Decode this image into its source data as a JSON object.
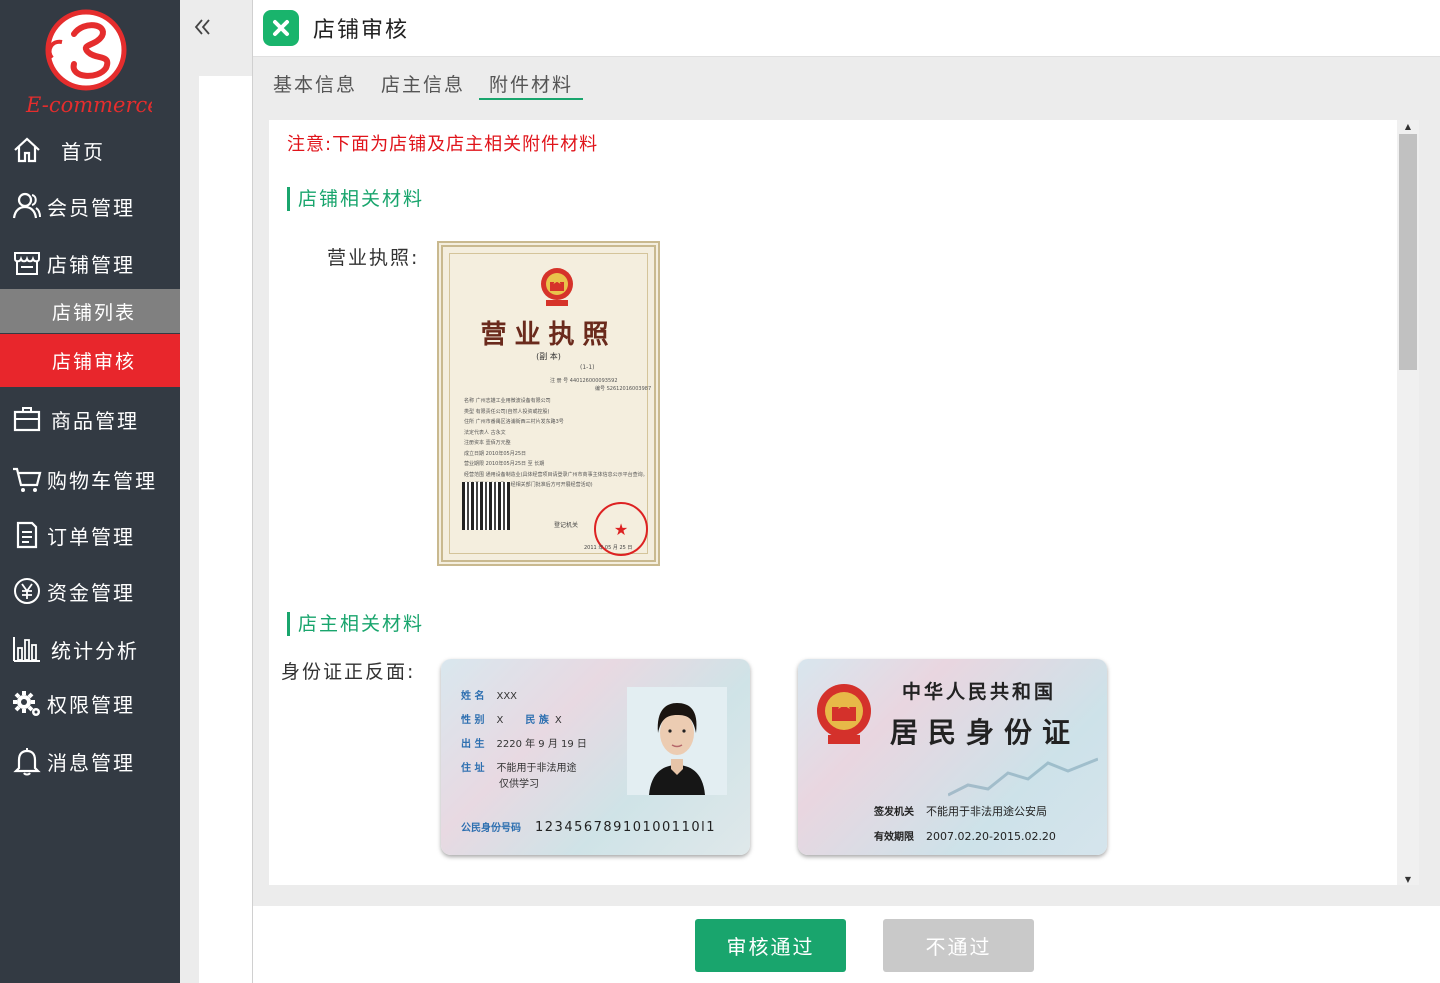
{
  "sidebar": {
    "logo_text": "E-commerce",
    "items": [
      {
        "label": "首页",
        "icon": "home-icon"
      },
      {
        "label": "会员管理",
        "icon": "users-icon"
      },
      {
        "label": "店铺管理",
        "icon": "store-icon"
      },
      {
        "label": "商品管理",
        "icon": "briefcase-icon"
      },
      {
        "label": "购物车管理",
        "icon": "cart-icon"
      },
      {
        "label": "订单管理",
        "icon": "document-icon"
      },
      {
        "label": "资金管理",
        "icon": "yuan-icon"
      },
      {
        "label": "统计分析",
        "icon": "bar-chart-icon"
      },
      {
        "label": "权限管理",
        "icon": "gear-icon"
      },
      {
        "label": "消息管理",
        "icon": "bell-icon"
      }
    ],
    "sub_items": [
      {
        "label": "店铺列表"
      },
      {
        "label": "店铺审核"
      }
    ],
    "active_color": "#e8262c"
  },
  "dialog": {
    "title": "店铺审核",
    "tabs": [
      {
        "label": "基本信息"
      },
      {
        "label": "店主信息"
      },
      {
        "label": "附件材料"
      }
    ],
    "notice": "注意:下面为店铺及店主相关附件材料",
    "sections": {
      "shop": {
        "title": "店铺相关材料",
        "license_label": "营业执照:"
      },
      "owner": {
        "title": "店主相关材料",
        "id_label": "身份证正反面:"
      }
    },
    "license": {
      "title": "营业执照",
      "subtitle": "(副 本)",
      "serial": "(1-1)",
      "registration_label": "注 册 号",
      "registration_no": "440126000093592",
      "code_label": "编号",
      "code": "S2612016003987",
      "seal_star": "★",
      "qr_caption": "登记机关",
      "date_text": "2011 年 05 月 25 日",
      "fields": [
        {
          "label": "名称",
          "value": "广州志雄工业用微波设备有限公司"
        },
        {
          "label": "类型",
          "value": "有限责任公司(自然人投资或控股)"
        },
        {
          "label": "住所",
          "value": "广州市番禺区洛浦街西三村片发东路3号"
        },
        {
          "label": "法定代表人",
          "value": "古永文"
        },
        {
          "label": "注册资本",
          "value": "壹佰万元整"
        },
        {
          "label": "成立日期",
          "value": "2010年05月25日"
        },
        {
          "label": "营业期限",
          "value": "2010年05月25日 至 长期"
        },
        {
          "label": "经营范围",
          "value": "通用设备制造业(具体经营项目请登录广州市商事主体信息公示平台查询。依法须经批准的项目,经相关部门批准后方可开展经营活动)"
        }
      ]
    },
    "id_front": {
      "name_label": "姓 名",
      "name": "XXX",
      "gender_label": "性 别",
      "gender": "X",
      "ethnicity_label": "民 族",
      "ethnicity": "X",
      "birth_label": "出 生",
      "birth": "2220 年 9 月 19 日",
      "address_label": "住 址",
      "address_line1": "不能用于非法用途",
      "address_line2": "仅供学习",
      "id_label": "公民身份号码",
      "id_number": "12345678910100110l1"
    },
    "id_back": {
      "title1": "中华人民共和国",
      "title2": "居民身份证",
      "authority_label": "签发机关",
      "authority": "不能用于非法用途公安局",
      "validity_label": "有效期限",
      "validity": "2007.02.20-2015.02.20"
    },
    "buttons": {
      "approve": "审核通过",
      "reject": "不通过"
    },
    "colors": {
      "primary_green": "#19a56d",
      "notice_red": "#e0141b",
      "sidebar_bg": "#333a43",
      "disabled_gray": "#c9c9c9"
    }
  }
}
